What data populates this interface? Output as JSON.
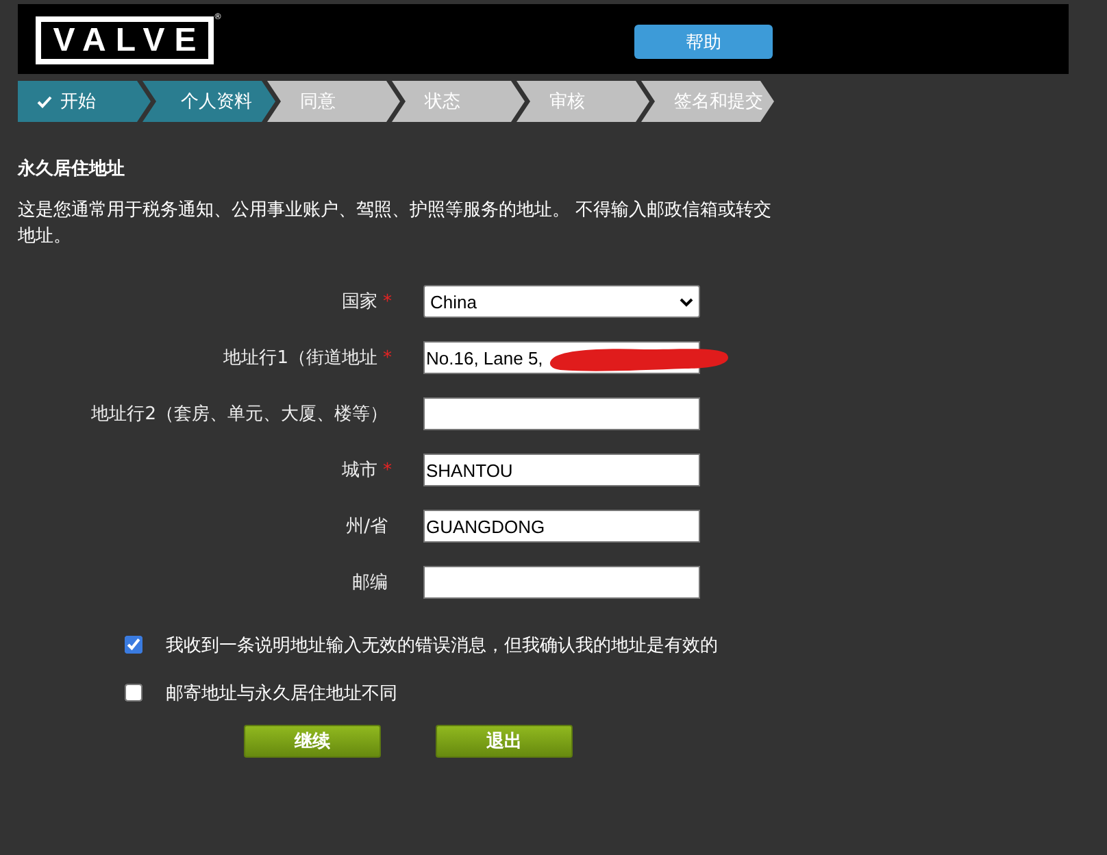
{
  "header": {
    "logo": {
      "text": "VALVE",
      "mark": "®"
    },
    "help_button": "帮助"
  },
  "steps": [
    {
      "label": "开始",
      "completed": true,
      "selected": false
    },
    {
      "label": "个人资料",
      "completed": false,
      "selected": true
    },
    {
      "label": "同意",
      "completed": false,
      "selected": false
    },
    {
      "label": "状态",
      "completed": false,
      "selected": false
    },
    {
      "label": "审核",
      "completed": false,
      "selected": false
    },
    {
      "label": "签名和提交",
      "completed": false,
      "selected": false
    }
  ],
  "section": {
    "title": "永久居住地址",
    "description": "这是您通常用于税务通知、公用事业账户、驾照、护照等服务的地址。 不得输入邮政信箱或转交地址。"
  },
  "form": {
    "required_mark": "*",
    "fields": [
      {
        "kind": "select",
        "label": "国家",
        "required": true,
        "value": "China"
      },
      {
        "kind": "text",
        "label": "地址行1（街道地址",
        "required": true,
        "value": "No.16, Lane 5,",
        "redacted": true
      },
      {
        "kind": "text",
        "label": "地址行2（套房、单元、大厦、楼等）",
        "required": false
      },
      {
        "kind": "text",
        "label": "城市",
        "required": true,
        "value": "SHANTOU"
      },
      {
        "kind": "text",
        "label": "州/省",
        "required": false,
        "value": "GUANGDONG"
      },
      {
        "kind": "text",
        "label": "邮编",
        "required": false
      }
    ],
    "checkboxes": [
      {
        "label": "我收到一条说明地址输入无效的错误消息，但我确认我的地址是有效的",
        "checked": true
      },
      {
        "label": "邮寄地址与永久居住地址不同",
        "checked": false
      }
    ],
    "buttons": [
      "继续",
      "退出"
    ]
  }
}
